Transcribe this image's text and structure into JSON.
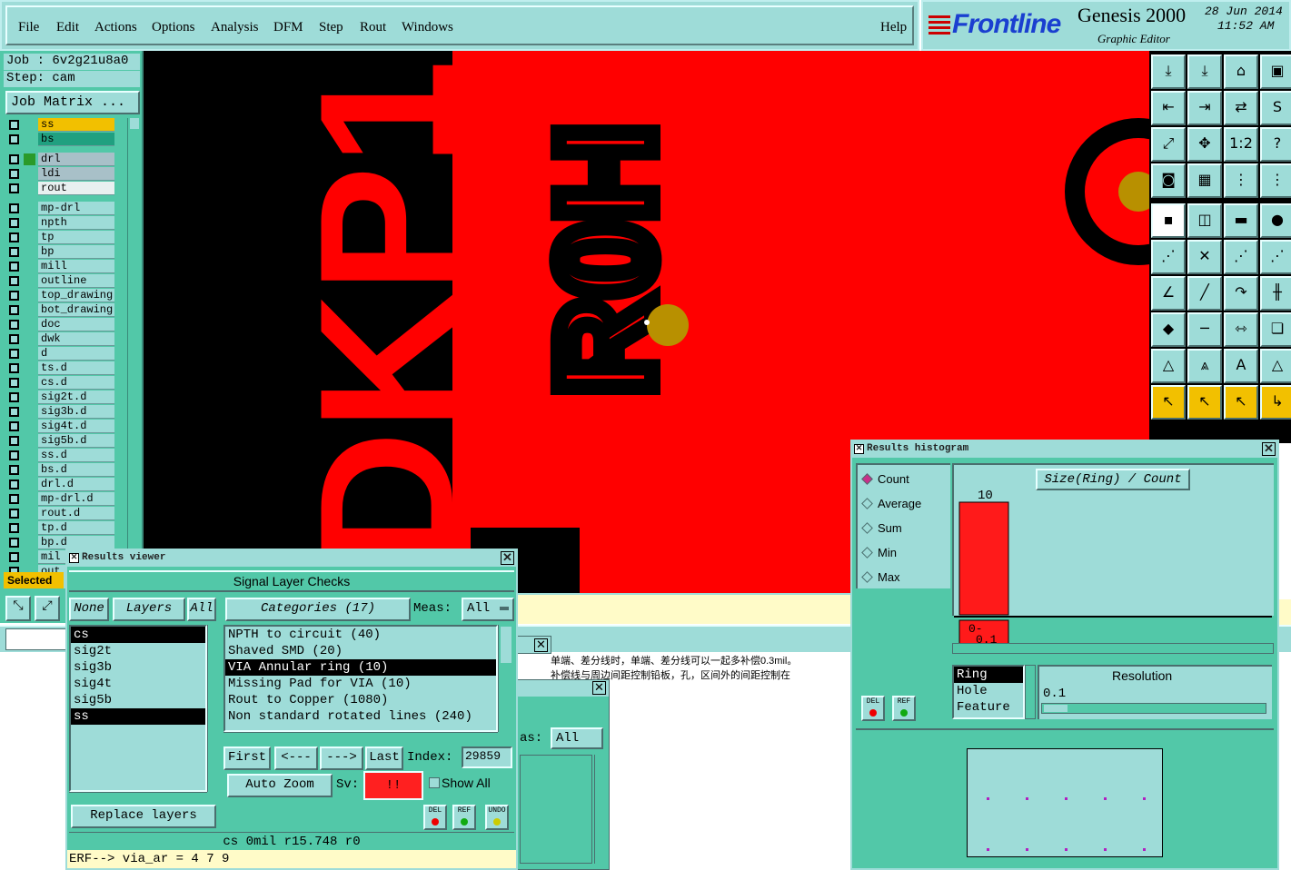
{
  "menubar": {
    "items": [
      "File",
      "Edit",
      "Actions",
      "Options",
      "Analysis",
      "DFM",
      "Step",
      "Rout",
      "Windows"
    ],
    "help": "Help"
  },
  "brand": {
    "logo": "Frontline",
    "product": "Genesis 2000",
    "subtitle": "Graphic Editor",
    "date": "28 Jun 2014",
    "time": "11:52 AM"
  },
  "left_panel": {
    "job": "Job : 6v2g21u8a0",
    "step": "Step: cam",
    "job_matrix": "Job Matrix ...",
    "layers": [
      "ss",
      "bs",
      "drl",
      "ldi",
      "rout",
      "mp-drl",
      "npth",
      "tp",
      "bp",
      "mill",
      "outline",
      "top_drawing",
      "bot_drawing",
      "doc",
      "dwk",
      "d",
      "ts.d",
      "cs.d",
      "sig2t.d",
      "sig3b.d",
      "sig4t.d",
      "sig5b.d",
      "ss.d",
      "bs.d",
      "drl.d",
      "mp-drl.d",
      "rout.d",
      "tp.d",
      "bp.d",
      "mil",
      "out"
    ],
    "selected_label": "Selected"
  },
  "canvas": {
    "text_large": "DKP1",
    "text_side": "R0H"
  },
  "results_viewer": {
    "title": "Results viewer",
    "header": "Signal Layer Checks",
    "none_btn": "None",
    "layers_btn": "Layers",
    "all_btn": "All",
    "categories_btn": "Categories (17)",
    "meas_label": "Meas:",
    "meas_value": "All",
    "layers": [
      "cs",
      "sig2t",
      "sig3b",
      "sig4t",
      "sig5b",
      "ss"
    ],
    "categories": [
      "NPTH to circuit (40)",
      "Shaved SMD (20)",
      "VIA Annular ring (10)",
      "Missing Pad for VIA (10)",
      "Rout to Copper (1080)",
      "Non standard rotated lines (240)"
    ],
    "first": "First",
    "prev": "<---",
    "next": "--->",
    "last": "Last",
    "index_label": "Index:",
    "index_value": "29859",
    "auto_zoom": "Auto Zoom",
    "sv_label": "Sv:",
    "sv_value": "!!",
    "show_all": "Show All",
    "replace_layers": "Replace layers",
    "del": "DEL",
    "ref": "REF",
    "undo": "UNDO",
    "status": "cs 0mil   r15.748   r0",
    "erf": "ERF--> via_ar = 4 7 9"
  },
  "background_window": {
    "meas_label": "as:",
    "meas_value": "All",
    "chinese_line1": "单端、差分线时，单端、差分线可以一起多补偿0.3mil。",
    "chinese_line2": "补偿线与周边间距控制铅板，孔，区间外的间距控制在"
  },
  "histogram": {
    "title": "Results histogram",
    "options": [
      "Count",
      "Average",
      "Sum",
      "Min",
      "Max"
    ],
    "selected_option": "Count",
    "chart_title": "Size(Ring) / Count",
    "bar_value": "10",
    "bar_label_1": "0-",
    "bar_label_2": "0.1",
    "fields": [
      "Ring",
      "Hole",
      "Feature"
    ],
    "resolution_label": "Resolution",
    "resolution_value": "0.1",
    "del": "DEL",
    "ref": "REF"
  },
  "chart_data": {
    "type": "bar",
    "title": "Size(Ring) / Count",
    "categories": [
      "0-0.1"
    ],
    "values": [
      10
    ]
  }
}
